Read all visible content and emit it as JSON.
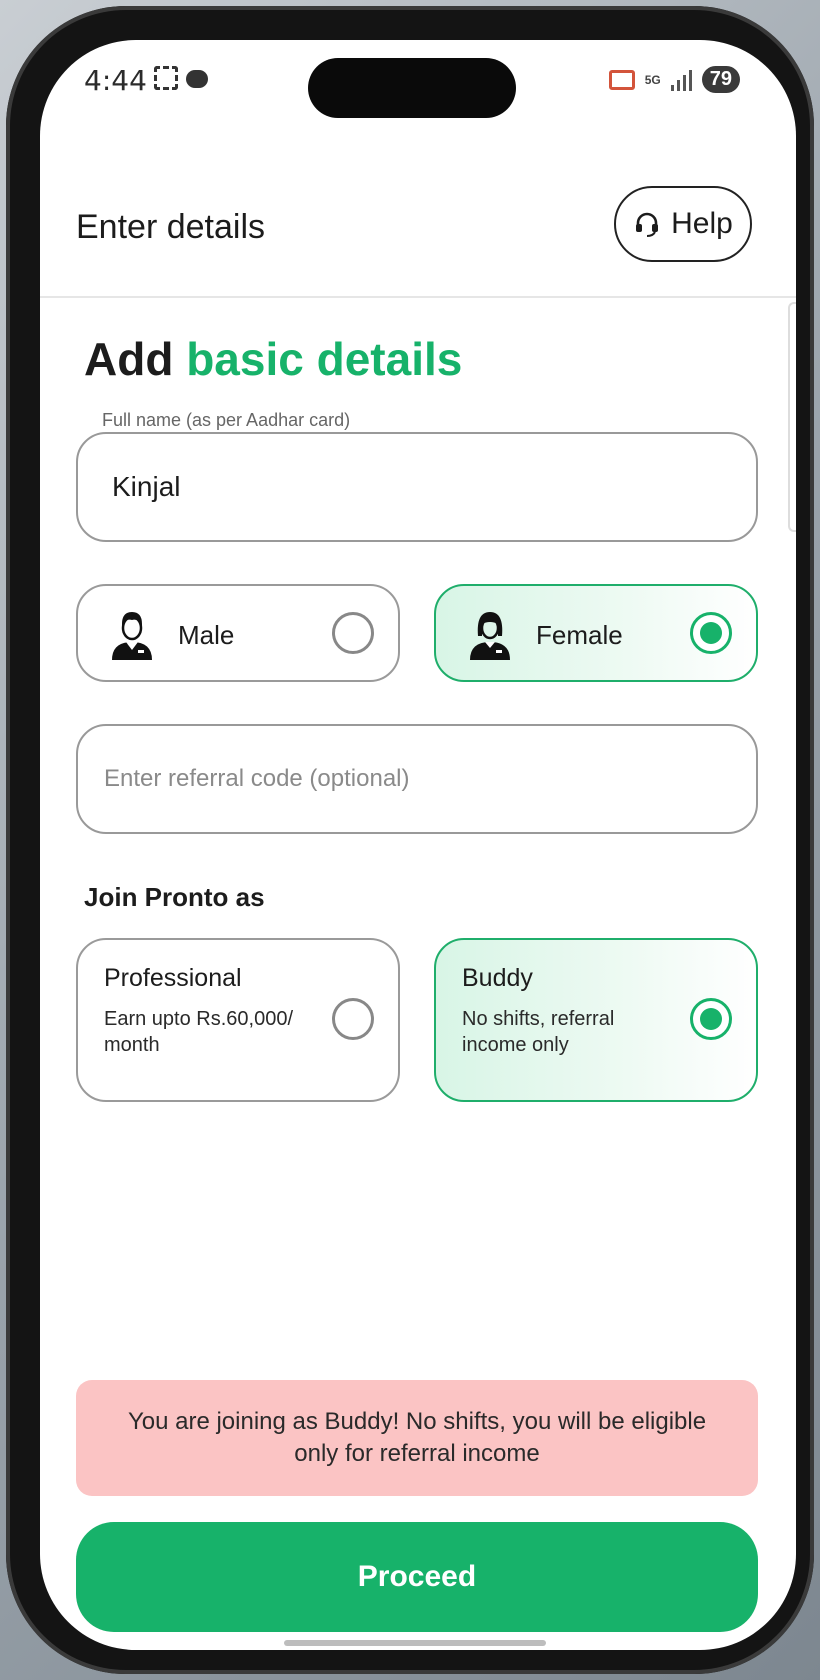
{
  "status_bar": {
    "time": "4:44",
    "network": "5G",
    "battery": "79",
    "icons": [
      "screenshot-frame-icon",
      "chat-bubble-icon",
      "cast-icon",
      "5g-data-icon",
      "signal-icon",
      "battery-icon"
    ]
  },
  "header": {
    "title": "Enter details",
    "help_label": "Help",
    "help_icon": "headset-icon"
  },
  "form": {
    "section_title_prefix": "Add",
    "section_title_accent": "basic details",
    "name": {
      "label": "Full name (as per Aadhar card)",
      "value": "Kinjal"
    },
    "gender": {
      "options": [
        {
          "label": "Male",
          "icon": "male-avatar-icon",
          "selected": false
        },
        {
          "label": "Female",
          "icon": "female-avatar-icon",
          "selected": true
        }
      ]
    },
    "referral": {
      "placeholder": "Enter referral code (optional)",
      "value": ""
    },
    "join": {
      "label": "Join Pronto as",
      "options": [
        {
          "title": "Professional",
          "description": "Earn upto Rs.60,000/ month",
          "selected": false
        },
        {
          "title": "Buddy",
          "description": "No shifts, referral income only",
          "selected": true
        }
      ]
    }
  },
  "notice": {
    "text": "You are joining as Buddy! No shifts, you will be eligible only for referral income"
  },
  "proceed_label": "Proceed",
  "colors": {
    "accent": "#17b26a",
    "notice_bg": "#fbc4c4",
    "selected_bg": "#d8f5e6"
  }
}
